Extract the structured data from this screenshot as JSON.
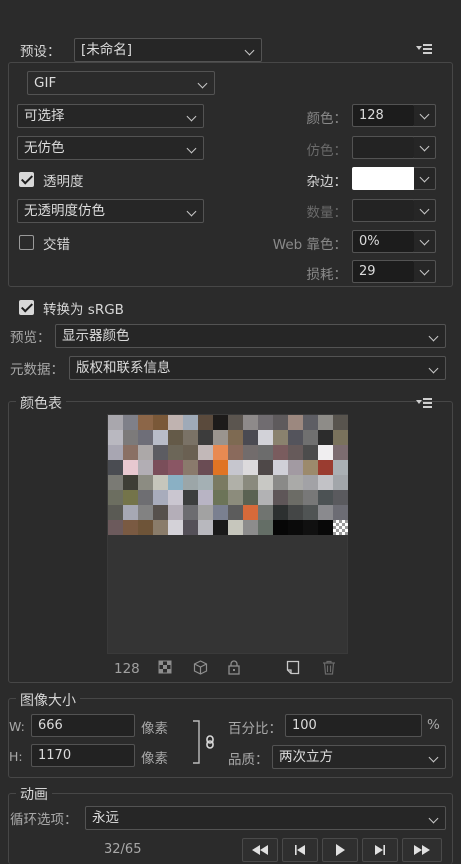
{
  "preset": {
    "label": "预设：",
    "value": "[未命名]"
  },
  "format": {
    "value": "GIF"
  },
  "reduction": {
    "value": "可选择"
  },
  "dither_algo": {
    "value": "无仿色"
  },
  "transparency": {
    "label": "透明度",
    "checked": true
  },
  "transparency_dither": {
    "value": "无透明度仿色"
  },
  "interlaced": {
    "label": "交错",
    "checked": false
  },
  "right_fields": {
    "colors": {
      "label": "颜色：",
      "value": "128"
    },
    "dither": {
      "label": "仿色：",
      "value": ""
    },
    "matte": {
      "label": "杂边：",
      "value": ""
    },
    "amount": {
      "label": "数量：",
      "value": ""
    },
    "web_snap": {
      "label": "Web 靠色：",
      "value": "0%"
    },
    "lossy": {
      "label": "损耗：",
      "value": "29"
    }
  },
  "convert_srgb": {
    "label": "转换为 sRGB",
    "checked": true
  },
  "preview": {
    "label": "预览：",
    "value": "显示器颜色"
  },
  "metadata": {
    "label": "元数据：",
    "value": "版权和联系信息"
  },
  "color_table": {
    "title": "颜色表",
    "count": "128",
    "swatches": [
      "#a9a7ad",
      "#7f8089",
      "#8c6648",
      "#7a5838",
      "#c0b3b0",
      "#9faab8",
      "#5a4a3c",
      "#1d1b1a",
      "#5b554f",
      "#8e8a8a",
      "#706c70",
      "#5e5a5c",
      "#9c887f",
      "#5e5e64",
      "#8e8c88",
      "#58544e",
      "#b9b8c0",
      "#7c7a7a",
      "#6e6e78",
      "#b8bcc8",
      "#645a48",
      "#7a7266",
      "#3c3c3c",
      "#9a948e",
      "#7e6a52",
      "#4a4a52",
      "#d2d2d8",
      "#8a826e",
      "#54545c",
      "#707070",
      "#2c2c2c",
      "#7a725c",
      "#a8a6b2",
      "#8a7064",
      "#aca8a8",
      "#5c5c62",
      "#6c6658",
      "#6a6052",
      "#c2b8b8",
      "#e88a52",
      "#8a6a5c",
      "#726c6c",
      "#6c6c6c",
      "#7a5c5e",
      "#665a5a",
      "#4c4c4c",
      "#f0eef0",
      "#7c6c70",
      "#4a4c52",
      "#e8c8d0",
      "#b2aeb4",
      "#7a4e5a",
      "#8a5664",
      "#8a7a6c",
      "#6a4c54",
      "#e07424",
      "#c6c6ce",
      "#dcdadc",
      "#4e4848",
      "#d0d0d8",
      "#a29aa2",
      "#9c8a6c",
      "#9a3c30",
      "#aab0b4",
      "#7a7a74",
      "#3e3e36",
      "#8c8c82",
      "#c6c6bc",
      "#8ab0c4",
      "#9ca6a8",
      "#a4b0b4",
      "#7a7a62",
      "#b0b0a8",
      "#8a8a7e",
      "#c8c8c4",
      "#8a8a88",
      "#aaaaa8",
      "#a2a2a6",
      "#c2c2c6",
      "#a2a6aa",
      "#6c6e60",
      "#74744a",
      "#6e6e72",
      "#a8acbc",
      "#cac6d0",
      "#3c3e3e",
      "#b8b4c4",
      "#6c7458",
      "#8c8c7c",
      "#5a6252",
      "#b2b2b4",
      "#5e5658",
      "#6c6c66",
      "#787878",
      "#4c5254",
      "#5a5a5e",
      "#5a5a54",
      "#a6a8b4",
      "#828282",
      "#56504c",
      "#b4aeb8",
      "#6c6c70",
      "#a2a2a2",
      "#7a8090",
      "#5c5c5c",
      "#d66a3a",
      "#707470",
      "#2c3030",
      "#444646",
      "#505454",
      "#8a8a8e",
      "#6c6c74",
      "#6c5a5c",
      "#7a5a42",
      "#6e5438",
      "#8a7c6a",
      "#d4d2d8",
      "#545058",
      "#b8b8be",
      "#1a1a1a",
      "#c6c6bc",
      "#8c8c8c",
      "#646e66",
      "#060606",
      "#0a0a0a",
      "#101010",
      "#080808",
      "transparent"
    ]
  },
  "image_size": {
    "title": "图像大小",
    "width": {
      "label": "W:",
      "value": "666",
      "unit": "像素"
    },
    "height": {
      "label": "H:",
      "value": "1170",
      "unit": "像素"
    },
    "percent": {
      "label": "百分比：",
      "value": "100",
      "unit": "%"
    },
    "quality": {
      "label": "品质：",
      "value": "两次立方"
    }
  },
  "animation": {
    "title": "动画",
    "loop": {
      "label": "循环选项：",
      "value": "永远"
    },
    "frame_counter": "32/65"
  }
}
